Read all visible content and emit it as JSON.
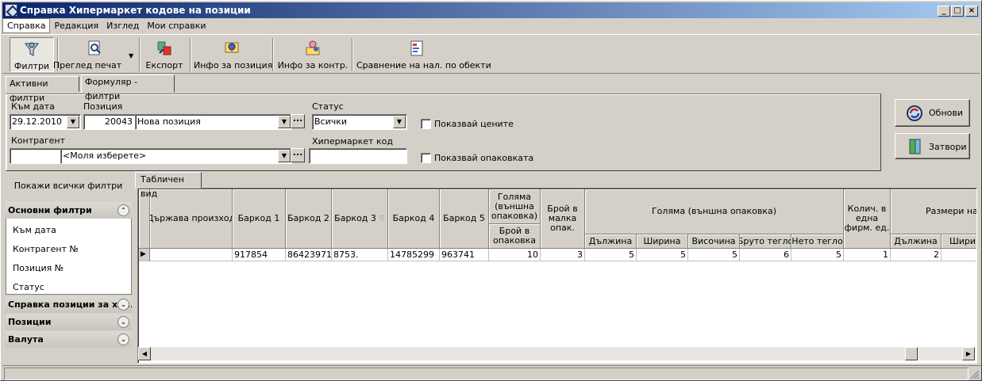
{
  "window": {
    "title": "Справка Хипермаркет кодове на позиции"
  },
  "menu": [
    "Справка",
    "Редакция",
    "Изглед",
    "Мои справки"
  ],
  "toolbar": {
    "filters": "Филтри",
    "print_preview": "Преглед печат",
    "export": "Експорт",
    "position_info": "Инфо за позиция",
    "contragent_info": "Инфо за контр.",
    "compare": "Сравнение на нал. по обекти"
  },
  "tabs": {
    "active_filters": "Активни филтри",
    "form_filters": "Формуляр - филтри"
  },
  "form": {
    "date_label": "Към дата",
    "date_value": "29.12.2010",
    "position_label": "Позиция",
    "position_code": "20043",
    "position_name": "Нова позиция",
    "status_label": "Статус",
    "status_value": "Всички",
    "show_prices": "Показвай цените",
    "contragent_label": "Контрагент",
    "contragent_code": "",
    "contragent_name": "<Моля изберете>",
    "hyper_code_label": "Хипермаркет код",
    "hyper_code_value": "",
    "show_packaging": "Показвай опаковката"
  },
  "buttons": {
    "refresh": "Обнови",
    "close": "Затвори"
  },
  "left_panel": {
    "show_all": "Покажи всички филтри",
    "categories": {
      "main": "Основни филтри",
      "report": "Справка позиции за хи...",
      "positions": "Позиции",
      "currency": "Валута"
    },
    "main_items": [
      "Към дата",
      "Контрагент №",
      "Позиция №",
      "Статус"
    ]
  },
  "table": {
    "tab": "Табличен вид",
    "headers": {
      "country": "Държава произход",
      "barcode1": "Баркод 1",
      "barcode2": "Баркод 2",
      "barcode3": "Баркод 3",
      "barcode4": "Баркод 4",
      "barcode5": "Баркод 5",
      "big_outer_top1": "Голяма",
      "big_outer_top2": "(външна",
      "big_outer_top3": "опаковка)",
      "count_in_pack1": "Брой в",
      "count_in_pack2": "опаковка",
      "count_small1": "Брой в",
      "count_small2": "малка",
      "count_small3": "опак.",
      "big_outer_group": "Голяма (външна опаковка)",
      "length": "Дължина",
      "width": "Ширина",
      "height": "Височина",
      "gross": "Бруто тегло",
      "net": "Нето тегло",
      "qty1": "Колич. в",
      "qty2": "една",
      "qty3": "фирм. ед.",
      "sizes": "Размери на",
      "length2": "Дължина",
      "width2": "Шири"
    },
    "row": {
      "country": "",
      "barcode1": "917854",
      "barcode2": "86423971",
      "barcode3": "8753.",
      "barcode4": "14785299",
      "barcode5": "963741",
      "count_in_pack": "10",
      "count_small": "3",
      "length": "5",
      "width": "5",
      "height": "5",
      "gross": "6",
      "net": "5",
      "qty": "1",
      "length2": "2",
      "width2": ""
    }
  }
}
